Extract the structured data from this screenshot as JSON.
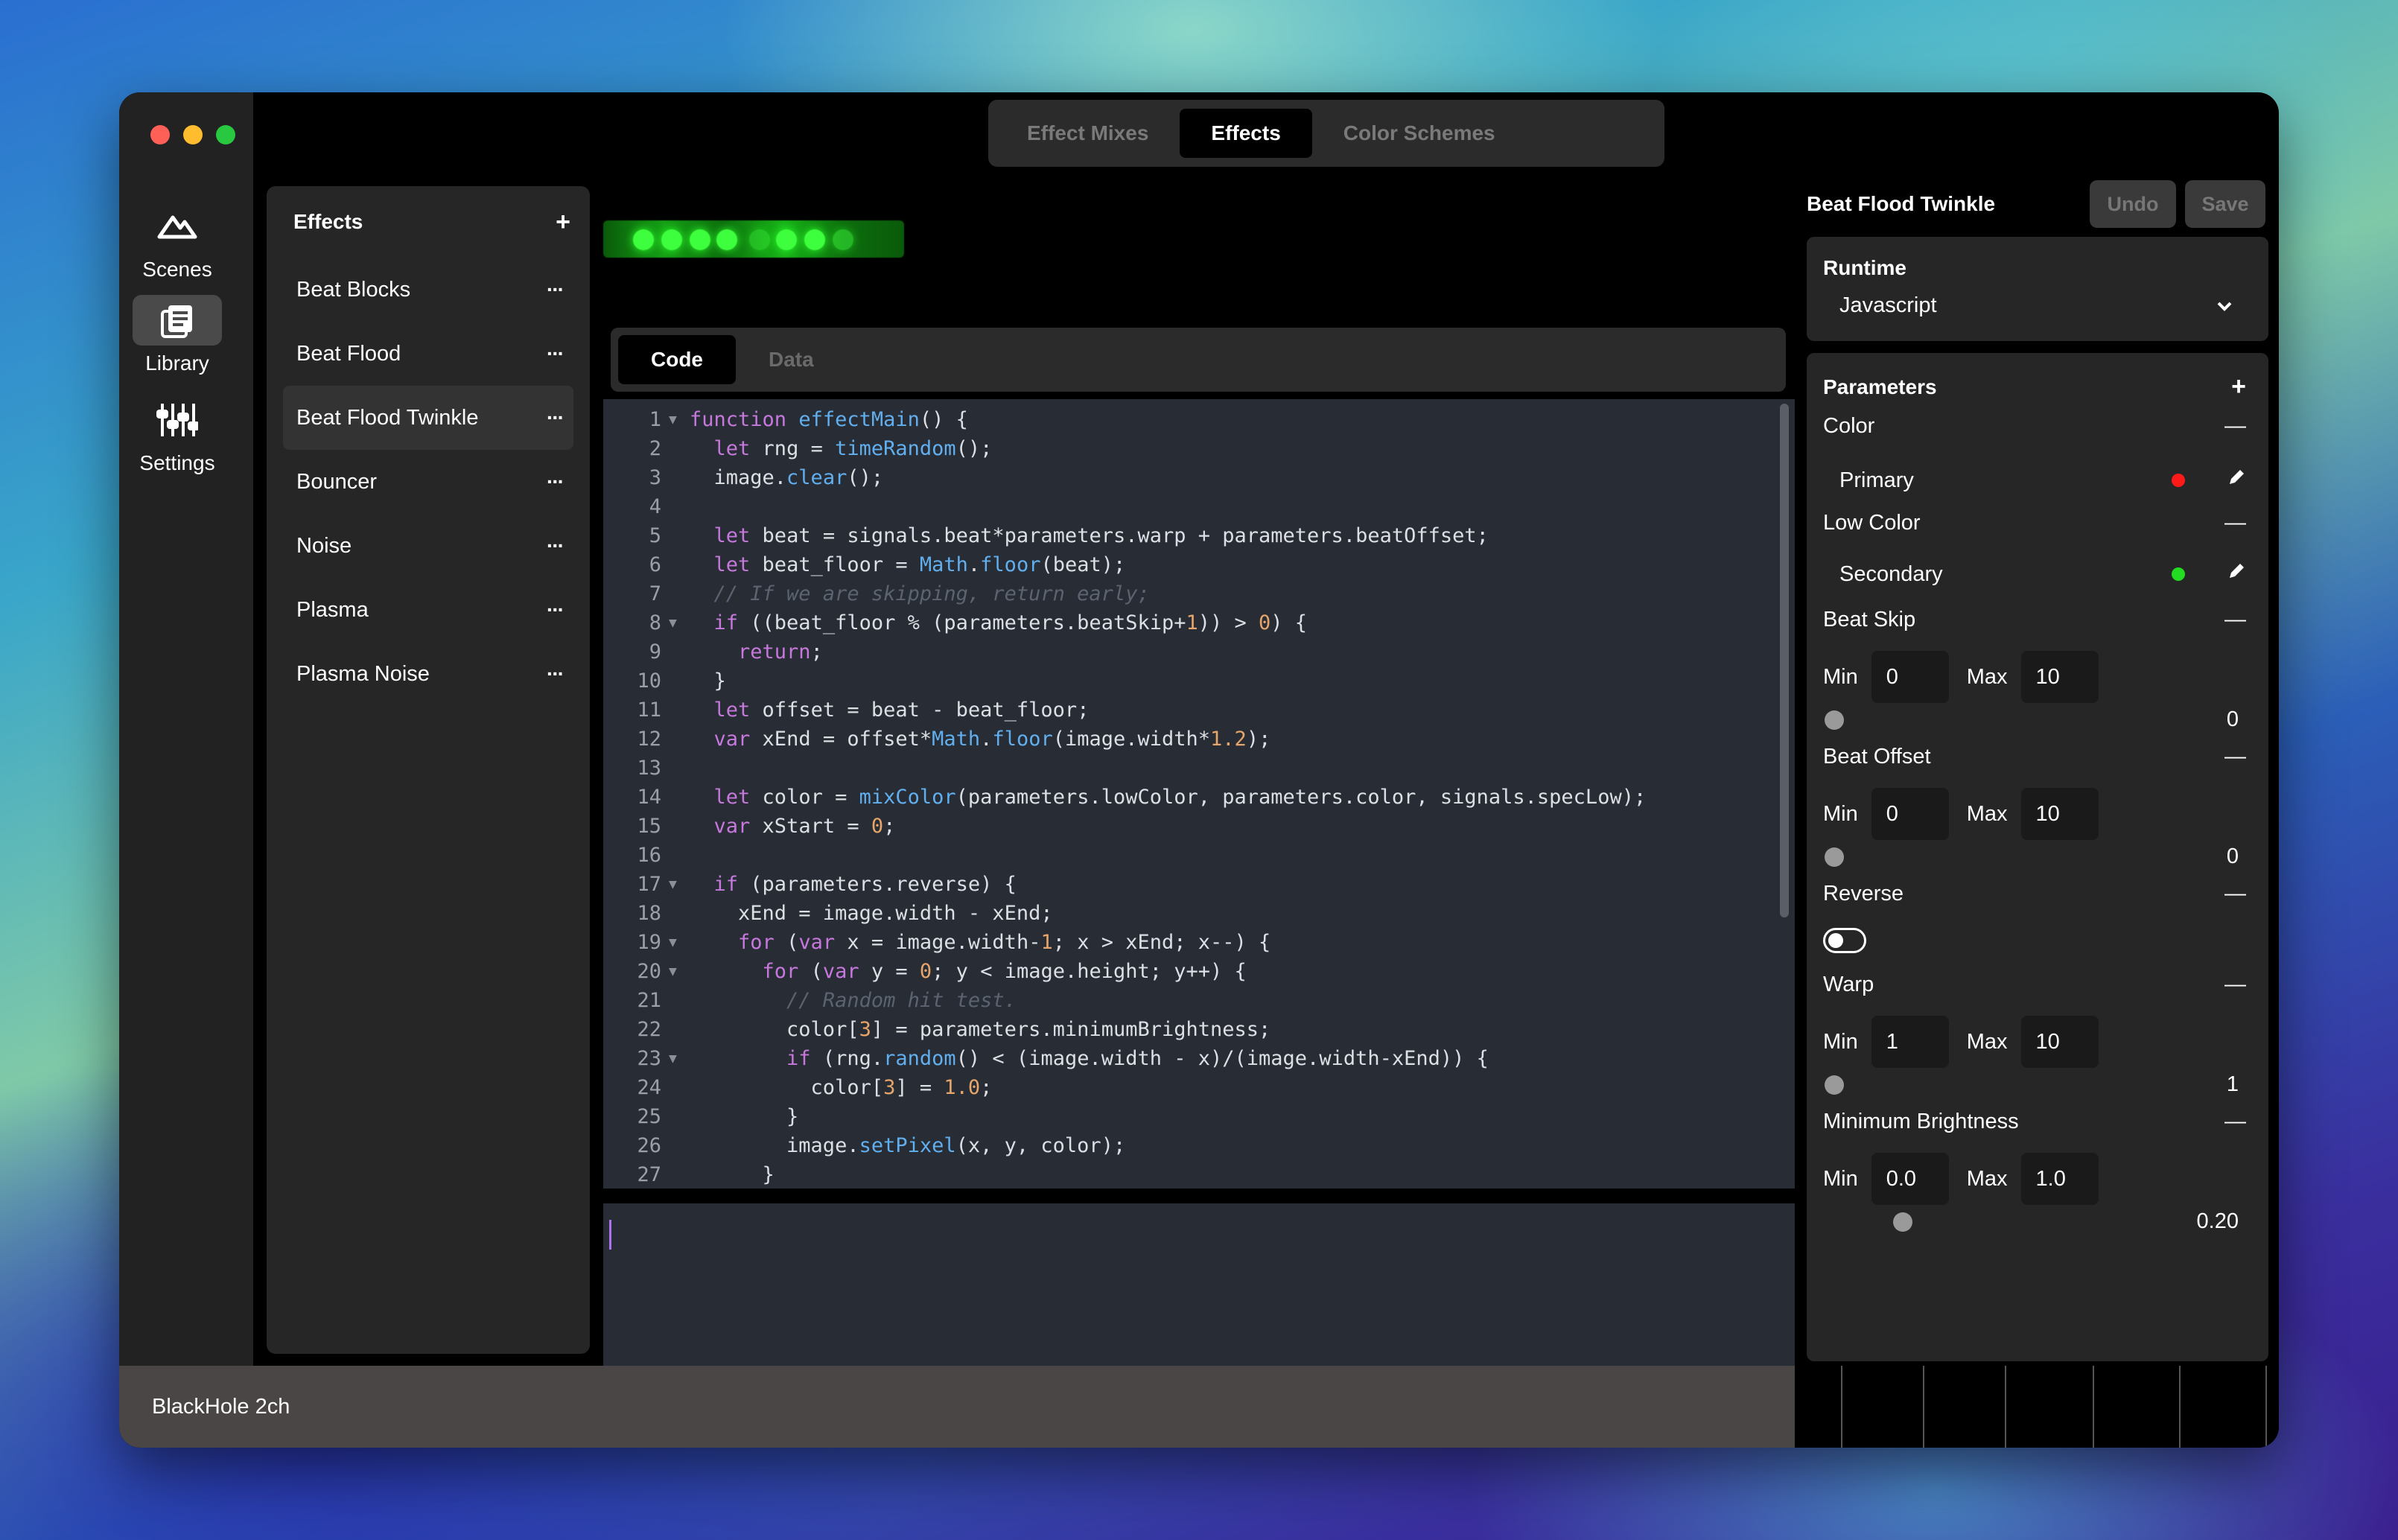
{
  "tabs": [
    "Effect Mixes",
    "Effects",
    "Color Schemes"
  ],
  "rail": [
    {
      "label": "Scenes",
      "icon": "mountain-icon"
    },
    {
      "label": "Library",
      "icon": "library-icon"
    },
    {
      "label": "Settings",
      "icon": "sliders-icon"
    }
  ],
  "effects_list": {
    "title": "Effects",
    "add": "+",
    "items": [
      "Beat Blocks",
      "Beat Flood",
      "Beat Flood Twinkle",
      "Bouncer",
      "Noise",
      "Plasma",
      "Plasma Noise"
    ],
    "more": "···"
  },
  "code_tabs": [
    "Code",
    "Data"
  ],
  "status": "BlackHole 2ch",
  "right": {
    "title": "Beat Flood Twinkle",
    "undo": "Undo",
    "save": "Save",
    "runtime_label": "Runtime",
    "runtime_value": "Javascript",
    "params_label": "Parameters",
    "add": "+",
    "minus": "—",
    "min": "Min",
    "max": "Max",
    "color": "Color",
    "primary": "Primary",
    "low_color": "Low Color",
    "secondary": "Secondary",
    "beat_skip": "Beat Skip",
    "beat_skip_min": "0",
    "beat_skip_max": "10",
    "beat_skip_val": "0",
    "beat_offset": "Beat Offset",
    "beat_offset_min": "0",
    "beat_offset_max": "10",
    "beat_offset_val": "0",
    "reverse": "Reverse",
    "warp": "Warp",
    "warp_min": "1",
    "warp_max": "10",
    "warp_val": "1",
    "min_brightness": "Minimum Brightness",
    "mb_min": "0.0",
    "mb_max": "1.0",
    "mb_val": "0.20",
    "primary_color": "#ff1a1a",
    "secondary_color": "#22dd22"
  },
  "code_lines": [
    "function effectMain() {",
    "  let rng = timeRandom();",
    "  image.clear();",
    "",
    "  let beat = signals.beat*parameters.warp + parameters.beatOffset;",
    "  let beat_floor = Math.floor(beat);",
    "  // If we are skipping, return early;",
    "  if ((beat_floor % (parameters.beatSkip+1)) > 0) {",
    "    return;",
    "  }",
    "  let offset = beat - beat_floor;",
    "  var xEnd = offset*Math.floor(image.width*1.2);",
    "",
    "  let color = mixColor(parameters.lowColor, parameters.color, signals.specLow);",
    "  var xStart = 0;",
    "",
    "  if (parameters.reverse) {",
    "    xEnd = image.width - xEnd;",
    "    for (var x = image.width-1; x > xEnd; x--) {",
    "      for (var y = 0; y < image.height; y++) {",
    "        // Random hit test.",
    "        color[3] = parameters.minimumBrightness;",
    "        if (rng.random() < (image.width - x)/(image.width-xEnd)) {",
    "          color[3] = 1.0;",
    "        }",
    "        image.setPixel(x, y, color);",
    "      }"
  ]
}
